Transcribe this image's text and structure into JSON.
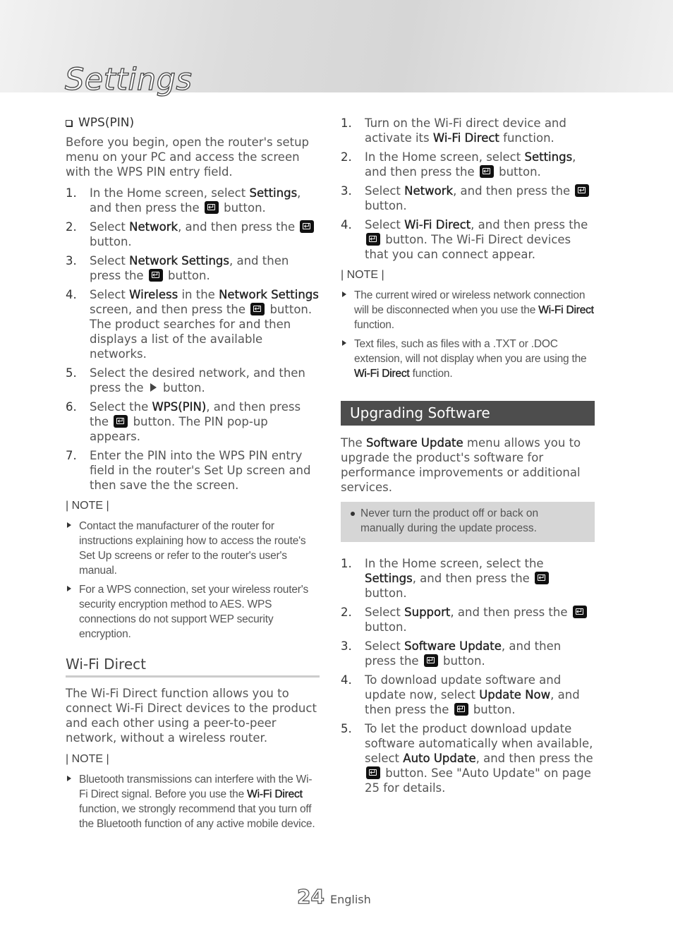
{
  "header": {
    "title": "Settings"
  },
  "left": {
    "wps": {
      "heading": "WPS(PIN)",
      "intro": "Before you begin, open the router's setup menu on your PC and access the screen with the WPS PIN entry field.",
      "steps": [
        {
          "num": "1.",
          "segments": [
            {
              "t": "text",
              "v": "In the Home screen, select "
            },
            {
              "t": "bold",
              "v": "Settings"
            },
            {
              "t": "text",
              "v": ", and then press the "
            },
            {
              "t": "icon",
              "v": "enter-icon"
            },
            {
              "t": "text",
              "v": " button."
            }
          ]
        },
        {
          "num": "2.",
          "segments": [
            {
              "t": "text",
              "v": "Select "
            },
            {
              "t": "bold",
              "v": "Network"
            },
            {
              "t": "text",
              "v": ", and then press the "
            },
            {
              "t": "icon",
              "v": "enter-icon"
            },
            {
              "t": "text",
              "v": " button."
            }
          ]
        },
        {
          "num": "3.",
          "segments": [
            {
              "t": "text",
              "v": "Select "
            },
            {
              "t": "bold",
              "v": "Network Settings"
            },
            {
              "t": "text",
              "v": ", and then press the "
            },
            {
              "t": "icon",
              "v": "enter-icon"
            },
            {
              "t": "text",
              "v": " button."
            }
          ]
        },
        {
          "num": "4.",
          "segments": [
            {
              "t": "text",
              "v": "Select "
            },
            {
              "t": "bold",
              "v": "Wireless"
            },
            {
              "t": "text",
              "v": " in the "
            },
            {
              "t": "bold",
              "v": "Network Settings"
            },
            {
              "t": "text",
              "v": " screen, and then press the "
            },
            {
              "t": "icon",
              "v": "enter-icon"
            },
            {
              "t": "text",
              "v": " button. The product searches for and then displays a list of the available networks."
            }
          ]
        },
        {
          "num": "5.",
          "segments": [
            {
              "t": "text",
              "v": "Select the desired network, and then press the "
            },
            {
              "t": "icon",
              "v": "play-icon"
            },
            {
              "t": "text",
              "v": " button."
            }
          ]
        },
        {
          "num": "6.",
          "segments": [
            {
              "t": "text",
              "v": "Select the "
            },
            {
              "t": "bold",
              "v": "WPS(PIN)"
            },
            {
              "t": "text",
              "v": ", and then press the "
            },
            {
              "t": "icon",
              "v": "enter-icon"
            },
            {
              "t": "text",
              "v": " button. The PIN pop-up appears."
            }
          ]
        },
        {
          "num": "7.",
          "segments": [
            {
              "t": "text",
              "v": "Enter the PIN into the WPS PIN entry field in the router's Set Up screen and then save the the screen."
            }
          ]
        }
      ],
      "note_label": "| NOTE |",
      "notes": [
        [
          {
            "t": "text",
            "v": "Contact the manufacturer of the router for instructions explaining how to access the route's Set Up screens or refer to the router's user's manual."
          }
        ],
        [
          {
            "t": "text",
            "v": "For a WPS connection, set your wireless router's security encryption method to AES. WPS connections do not support WEP security encryption."
          }
        ]
      ]
    },
    "wifi_direct": {
      "heading": "Wi-Fi Direct",
      "intro": "The Wi-Fi Direct function allows you to connect Wi-Fi Direct devices to the product and each other using a peer-to-peer network, without a wireless router.",
      "note_label": "| NOTE |",
      "notes": [
        [
          {
            "t": "text",
            "v": "Bluetooth transmissions can interfere with the Wi-Fi Direct signal. Before you use the "
          },
          {
            "t": "bold",
            "v": "Wi-Fi Direct"
          },
          {
            "t": "text",
            "v": " function, we strongly recommend that you turn off the Bluetooth function of any active mobile device."
          }
        ]
      ]
    }
  },
  "right": {
    "wifi_steps": [
      {
        "num": "1.",
        "segments": [
          {
            "t": "text",
            "v": "Turn on the Wi-Fi direct device and activate its "
          },
          {
            "t": "bold",
            "v": "Wi-Fi Direct"
          },
          {
            "t": "text",
            "v": " function."
          }
        ]
      },
      {
        "num": "2.",
        "segments": [
          {
            "t": "text",
            "v": "In the Home screen, select "
          },
          {
            "t": "bold",
            "v": "Settings"
          },
          {
            "t": "text",
            "v": ", and then press the "
          },
          {
            "t": "icon",
            "v": "enter-icon"
          },
          {
            "t": "text",
            "v": " button."
          }
        ]
      },
      {
        "num": "3.",
        "segments": [
          {
            "t": "text",
            "v": "Select "
          },
          {
            "t": "bold",
            "v": "Network"
          },
          {
            "t": "text",
            "v": ", and then press the "
          },
          {
            "t": "icon",
            "v": "enter-icon"
          },
          {
            "t": "text",
            "v": " button."
          }
        ]
      },
      {
        "num": "4.",
        "segments": [
          {
            "t": "text",
            "v": "Select "
          },
          {
            "t": "bold",
            "v": "Wi-Fi Direct"
          },
          {
            "t": "text",
            "v": ", and then press the "
          },
          {
            "t": "icon",
            "v": "enter-icon"
          },
          {
            "t": "text",
            "v": " button. The Wi-Fi Direct devices that you can connect appear."
          }
        ]
      }
    ],
    "note_label": "| NOTE |",
    "notes": [
      [
        {
          "t": "text",
          "v": "The current wired or wireless network connection will be disconnected when you use the "
        },
        {
          "t": "bold",
          "v": "Wi-Fi Direct"
        },
        {
          "t": "text",
          "v": " function."
        }
      ],
      [
        {
          "t": "text",
          "v": "Text files, such as files with a .TXT or .DOC extension, will not display when you are using the "
        },
        {
          "t": "bold",
          "v": "Wi-Fi Direct"
        },
        {
          "t": "text",
          "v": " function."
        }
      ]
    ],
    "upgrade": {
      "heading": "Upgrading Software",
      "intro": [
        {
          "t": "text",
          "v": "The "
        },
        {
          "t": "bold",
          "v": "Software Update"
        },
        {
          "t": "text",
          "v": " menu allows you to upgrade the product's software for performance improvements or additional services."
        }
      ],
      "warning": "Never turn the product off or back on manually during the update process.",
      "steps": [
        {
          "num": "1.",
          "segments": [
            {
              "t": "text",
              "v": "In the Home screen, select the "
            },
            {
              "t": "bold",
              "v": "Settings"
            },
            {
              "t": "text",
              "v": ", and then press the "
            },
            {
              "t": "icon",
              "v": "enter-icon"
            },
            {
              "t": "text",
              "v": " button."
            }
          ]
        },
        {
          "num": "2.",
          "segments": [
            {
              "t": "text",
              "v": "Select "
            },
            {
              "t": "bold",
              "v": "Support"
            },
            {
              "t": "text",
              "v": ", and then press the "
            },
            {
              "t": "icon",
              "v": "enter-icon"
            },
            {
              "t": "text",
              "v": " button."
            }
          ]
        },
        {
          "num": "3.",
          "segments": [
            {
              "t": "text",
              "v": "Select "
            },
            {
              "t": "bold",
              "v": "Software Update"
            },
            {
              "t": "text",
              "v": ", and then press the "
            },
            {
              "t": "icon",
              "v": "enter-icon"
            },
            {
              "t": "text",
              "v": " button."
            }
          ]
        },
        {
          "num": "4.",
          "segments": [
            {
              "t": "text",
              "v": "To download update software and update now, select "
            },
            {
              "t": "bold",
              "v": "Update Now"
            },
            {
              "t": "text",
              "v": ", and then press the "
            },
            {
              "t": "icon",
              "v": "enter-icon"
            },
            {
              "t": "text",
              "v": " button."
            }
          ]
        },
        {
          "num": "5.",
          "segments": [
            {
              "t": "text",
              "v": "To let the product download update software automatically when available, select "
            },
            {
              "t": "bold",
              "v": "Auto Update"
            },
            {
              "t": "text",
              "v": ", and then press the "
            },
            {
              "t": "icon",
              "v": "enter-icon"
            },
            {
              "t": "text",
              "v": " button. See \"Auto Update\" on page 25 for details."
            }
          ]
        }
      ]
    }
  },
  "footer": {
    "page_number": "24",
    "language": "English"
  }
}
